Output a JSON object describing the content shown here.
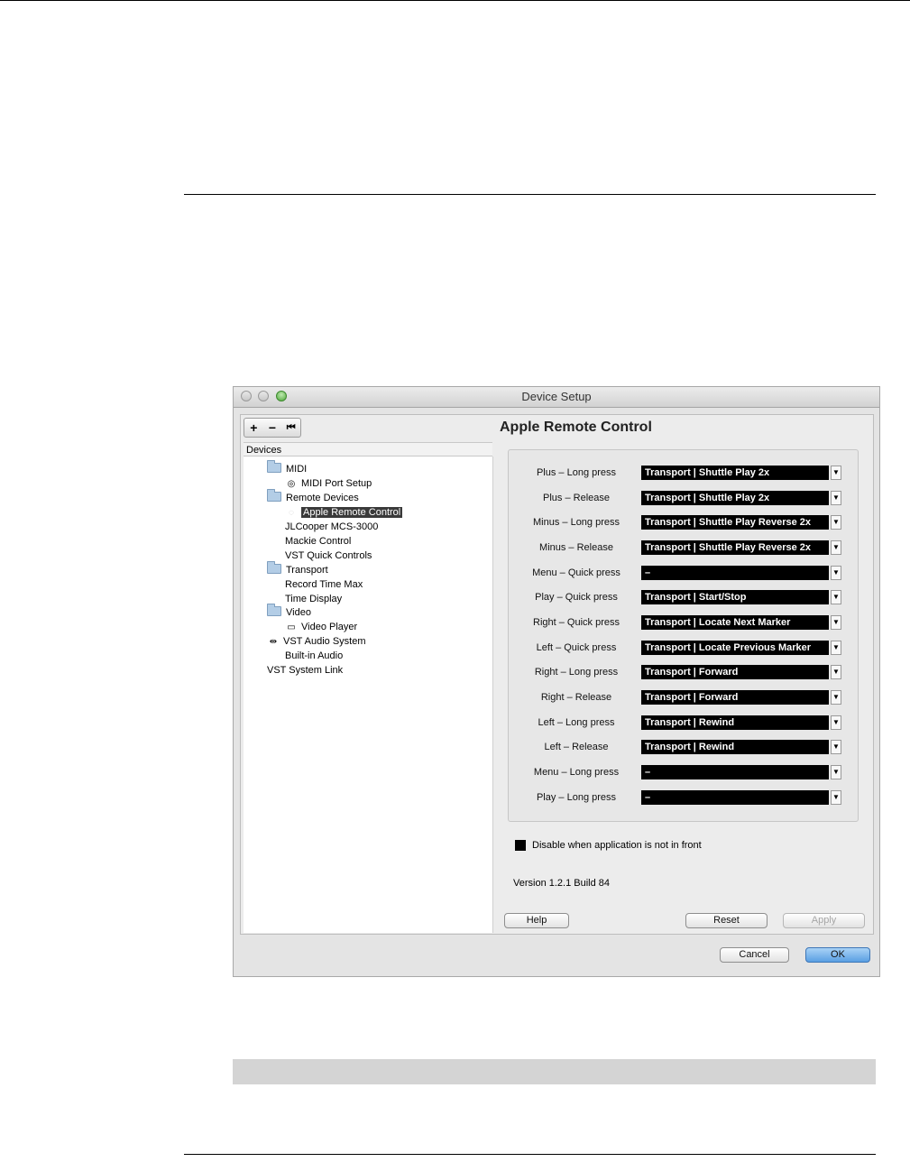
{
  "window": {
    "title": "Device Setup"
  },
  "toolbar": {
    "add": "+",
    "remove": "−",
    "reset": "⏮"
  },
  "devices_header": "Devices",
  "tree": [
    {
      "label": "MIDI",
      "type": "folder"
    },
    {
      "label": "MIDI Port Setup",
      "type": "item",
      "icon": "midi-port-icon"
    },
    {
      "label": "Remote Devices",
      "type": "folder"
    },
    {
      "label": "Apple Remote Control",
      "type": "item",
      "selected": true,
      "icon": "remote-icon"
    },
    {
      "label": "JLCooper MCS-3000",
      "type": "item"
    },
    {
      "label": "Mackie Control",
      "type": "item"
    },
    {
      "label": "VST Quick Controls",
      "type": "item"
    },
    {
      "label": "Transport",
      "type": "folder"
    },
    {
      "label": "Record Time Max",
      "type": "item"
    },
    {
      "label": "Time Display",
      "type": "item"
    },
    {
      "label": "Video",
      "type": "folder"
    },
    {
      "label": "Video Player",
      "type": "item",
      "icon": "video-icon"
    },
    {
      "label": "VST Audio System",
      "type": "item",
      "icon": "audio-system-icon"
    },
    {
      "label": "Built-in Audio",
      "type": "item"
    },
    {
      "label": "VST System Link",
      "type": "item"
    }
  ],
  "panel": {
    "title": "Apple Remote Control",
    "rows": [
      {
        "label": "Plus – Long press",
        "value": "Transport | Shuttle Play 2x"
      },
      {
        "label": "Plus – Release",
        "value": "Transport | Shuttle Play 2x"
      },
      {
        "label": "Minus – Long press",
        "value": "Transport | Shuttle Play Reverse 2x"
      },
      {
        "label": "Minus – Release",
        "value": "Transport | Shuttle Play Reverse 2x"
      },
      {
        "label": "Menu – Quick press",
        "value": "–"
      },
      {
        "label": "Play – Quick press",
        "value": "Transport | Start/Stop"
      },
      {
        "label": "Right – Quick press",
        "value": "Transport | Locate Next Marker"
      },
      {
        "label": "Left – Quick press",
        "value": "Transport | Locate Previous Marker"
      },
      {
        "label": "Right – Long press",
        "value": "Transport | Forward"
      },
      {
        "label": "Right – Release",
        "value": "Transport | Forward"
      },
      {
        "label": "Left – Long press",
        "value": "Transport | Rewind"
      },
      {
        "label": "Left – Release",
        "value": "Transport | Rewind"
      },
      {
        "label": "Menu – Long press",
        "value": "–"
      },
      {
        "label": "Play – Long press",
        "value": "–"
      }
    ],
    "disable_checkbox": {
      "label": "Disable when application is not in front",
      "checked": true
    },
    "version": "Version 1.2.1 Build 84"
  },
  "buttons": {
    "help": "Help",
    "reset": "Reset",
    "apply": "Apply",
    "cancel": "Cancel",
    "ok": "OK"
  }
}
